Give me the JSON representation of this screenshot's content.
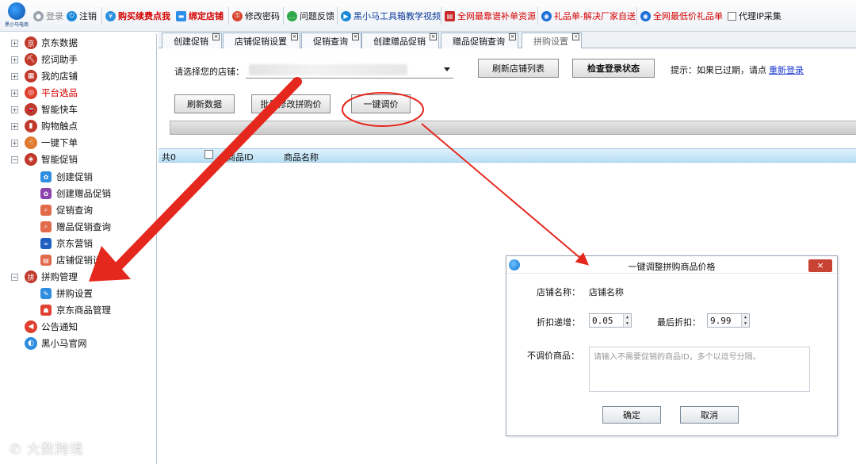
{
  "app": {
    "logo_text": "黑小马电商"
  },
  "toolbar": {
    "items": [
      {
        "label": "登录",
        "icon": "user-icon"
      },
      {
        "label": "注销",
        "icon": "power-icon"
      },
      {
        "label": "购买续费点我",
        "icon": "cart-icon"
      },
      {
        "label": "绑定店铺",
        "icon": "shop-bind-icon"
      },
      {
        "label": "修改密码",
        "icon": "key-icon"
      },
      {
        "label": "问题反馈",
        "icon": "chat-icon"
      },
      {
        "label": "黑小马工具箱教学视频",
        "icon": "play-icon"
      },
      {
        "label": "全网最靠谱补单资源",
        "icon": "doc-icon"
      },
      {
        "label": "礼品单-解决厂家自送",
        "icon": "gift-icon"
      },
      {
        "label": "全网最低价礼品单",
        "icon": "gift-icon"
      },
      {
        "label": "代理IP采集",
        "icon": "checkbox-icon"
      }
    ]
  },
  "sidebar": {
    "items": [
      {
        "label": "京东数据",
        "expander": "+",
        "icon": "jd-data-icon"
      },
      {
        "label": "挖词助手",
        "expander": "+",
        "icon": "keyword-icon"
      },
      {
        "label": "我的店铺",
        "expander": "+",
        "icon": "store-icon"
      },
      {
        "label": "平台选品",
        "expander": "+",
        "icon": "select-product-icon"
      },
      {
        "label": "智能快车",
        "expander": "+",
        "icon": "car-icon"
      },
      {
        "label": "购物触点",
        "expander": "+",
        "icon": "touchpoint-icon"
      },
      {
        "label": "一键下单",
        "expander": "+",
        "icon": "order-icon"
      },
      {
        "label": "智能促销",
        "expander": "−",
        "icon": "promo-icon"
      },
      {
        "label": "创建促销",
        "child": true,
        "icon": "create-promo-icon"
      },
      {
        "label": "创建赠品促销",
        "child": true,
        "icon": "gift-promo-icon"
      },
      {
        "label": "促销查询",
        "child": true,
        "icon": "search-promo-icon"
      },
      {
        "label": "赠品促销查询",
        "child": true,
        "icon": "search-gift-icon"
      },
      {
        "label": "京东营销",
        "child": true,
        "icon": "marketing-icon"
      },
      {
        "label": "店铺促销设置",
        "child": true,
        "icon": "store-promo-icon"
      },
      {
        "label": "拼购管理",
        "expander": "−",
        "icon": "group-buy-icon"
      },
      {
        "label": "拼购设置",
        "child": true,
        "icon": "group-settings-icon"
      },
      {
        "label": "京东商品管理",
        "child": true,
        "icon": "goods-icon"
      },
      {
        "label": "公告通知",
        "icon": "notice-icon"
      },
      {
        "label": "黑小马官网",
        "icon": "website-icon"
      }
    ]
  },
  "tabs": [
    {
      "label": "创建促销"
    },
    {
      "label": "店铺促销设置"
    },
    {
      "label": "促销查询"
    },
    {
      "label": "创建赠品促销"
    },
    {
      "label": "赠品促销查询"
    },
    {
      "label": "拼购设置",
      "active": true
    }
  ],
  "main": {
    "store_label": "请选择您的店铺：",
    "refresh_store_list": "刷新店铺列表",
    "check_login": "检查登录状态",
    "hint": "提示：如果已过期，请点",
    "relogin": "重新登录",
    "refresh_data": "刷新数据",
    "batch_modify": "批量修改拼购价",
    "one_click": "一键调价",
    "grid": {
      "count": "共0",
      "col_id": "商品ID",
      "col_name": "商品名称"
    }
  },
  "dialog": {
    "title": "一键调整拼购商品价格",
    "close": "×",
    "store_name_label": "店铺名称：",
    "store_name_value": "店铺名称",
    "discount_step_label": "折扣递增：",
    "discount_step_value": "0.05",
    "final_discount_label": "最后折扣：",
    "final_discount_value": "9.99",
    "exclude_label": "不调价商品：",
    "exclude_placeholder": "请输入不需要促销的商品ID，多个以逗号分隔。",
    "ok": "确定",
    "cancel": "取消"
  },
  "watermark": "大数跨境",
  "colors": {
    "accent": "#1174d6",
    "annotation": "#e5281e",
    "grid_header": "#b9dff5"
  }
}
